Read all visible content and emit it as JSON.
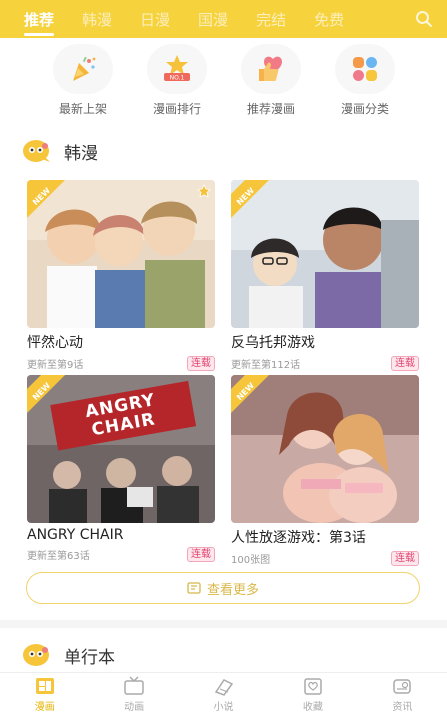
{
  "top_tabs": [
    "推荐",
    "韩漫",
    "日漫",
    "国漫",
    "完结",
    "免费"
  ],
  "quick_links": [
    {
      "label": "最新上架",
      "icon": "party-popper-icon"
    },
    {
      "label": "漫画排行",
      "icon": "ranking-badge-icon"
    },
    {
      "label": "推荐漫画",
      "icon": "thumbs-up-heart-icon"
    },
    {
      "label": "漫画分类",
      "icon": "category-grid-icon"
    }
  ],
  "section1": {
    "title": "韩漫"
  },
  "cards": [
    {
      "title": "怦然心动",
      "update": "更新至第9话",
      "badge": "连载",
      "new_tag": "NEW"
    },
    {
      "title": "反乌托邦游戏",
      "update": "更新至第112话",
      "badge": "连载",
      "new_tag": "NEW"
    },
    {
      "title": "ANGRY CHAIR",
      "update": "更新至第63话",
      "badge": "连载",
      "new_tag": "NEW",
      "cover_text": "ANGRY CHAIR"
    },
    {
      "title": "人性放逐游戏：第3话",
      "update": "100张图",
      "badge": "连载",
      "new_tag": "NEW"
    }
  ],
  "more_button": "查看更多",
  "section2": {
    "title": "单行本"
  },
  "bottom_tabs": [
    {
      "label": "漫画",
      "icon": "comic-icon",
      "active": true
    },
    {
      "label": "动画",
      "icon": "tv-icon",
      "active": false
    },
    {
      "label": "小说",
      "icon": "book-icon",
      "active": false
    },
    {
      "label": "收藏",
      "icon": "heart-box-icon",
      "active": false
    },
    {
      "label": "资讯",
      "icon": "news-icon",
      "active": false
    }
  ],
  "colors": {
    "accent": "#f6d23c",
    "badge": "#e2456f",
    "active_tab": "#e6b400"
  }
}
